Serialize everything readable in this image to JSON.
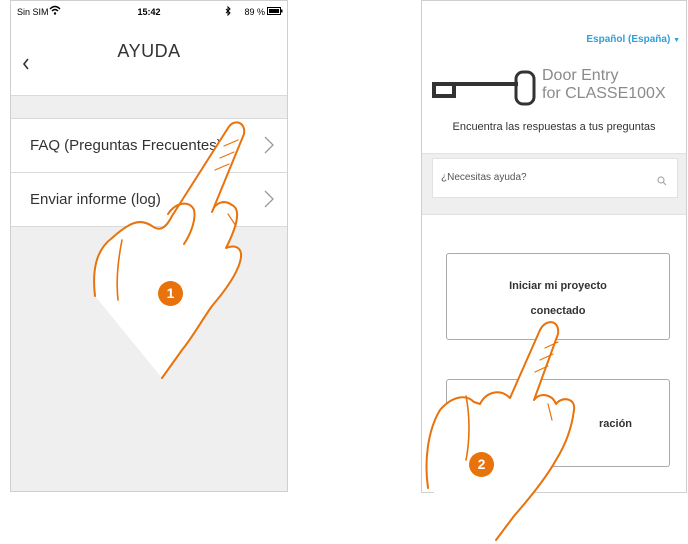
{
  "left_phone": {
    "status_bar": {
      "carrier": "Sin SIM",
      "time": "15:42",
      "battery": "89 %"
    },
    "nav": {
      "title": "AYUDA"
    },
    "menu": [
      {
        "label": "FAQ (Preguntas Frecuentes)"
      },
      {
        "label": "Enviar informe (log)"
      }
    ]
  },
  "right_phone": {
    "language": "Español (España)",
    "logo": {
      "line1": "Door Entry",
      "line2": "for CLASSE100X"
    },
    "tagline": "Encuentra las respuestas a tus preguntas",
    "search": {
      "placeholder": "¿Necesitas ayuda?"
    },
    "cards": [
      {
        "line1": "Iniciar mi proyecto",
        "line2": "conectado"
      },
      {
        "visible_fragment": "ración"
      }
    ]
  },
  "steps": [
    "1",
    "2"
  ],
  "colors": {
    "accent_orange": "#e8720c",
    "language_link": "#2f9ed9",
    "panel_gray": "#efefef"
  }
}
